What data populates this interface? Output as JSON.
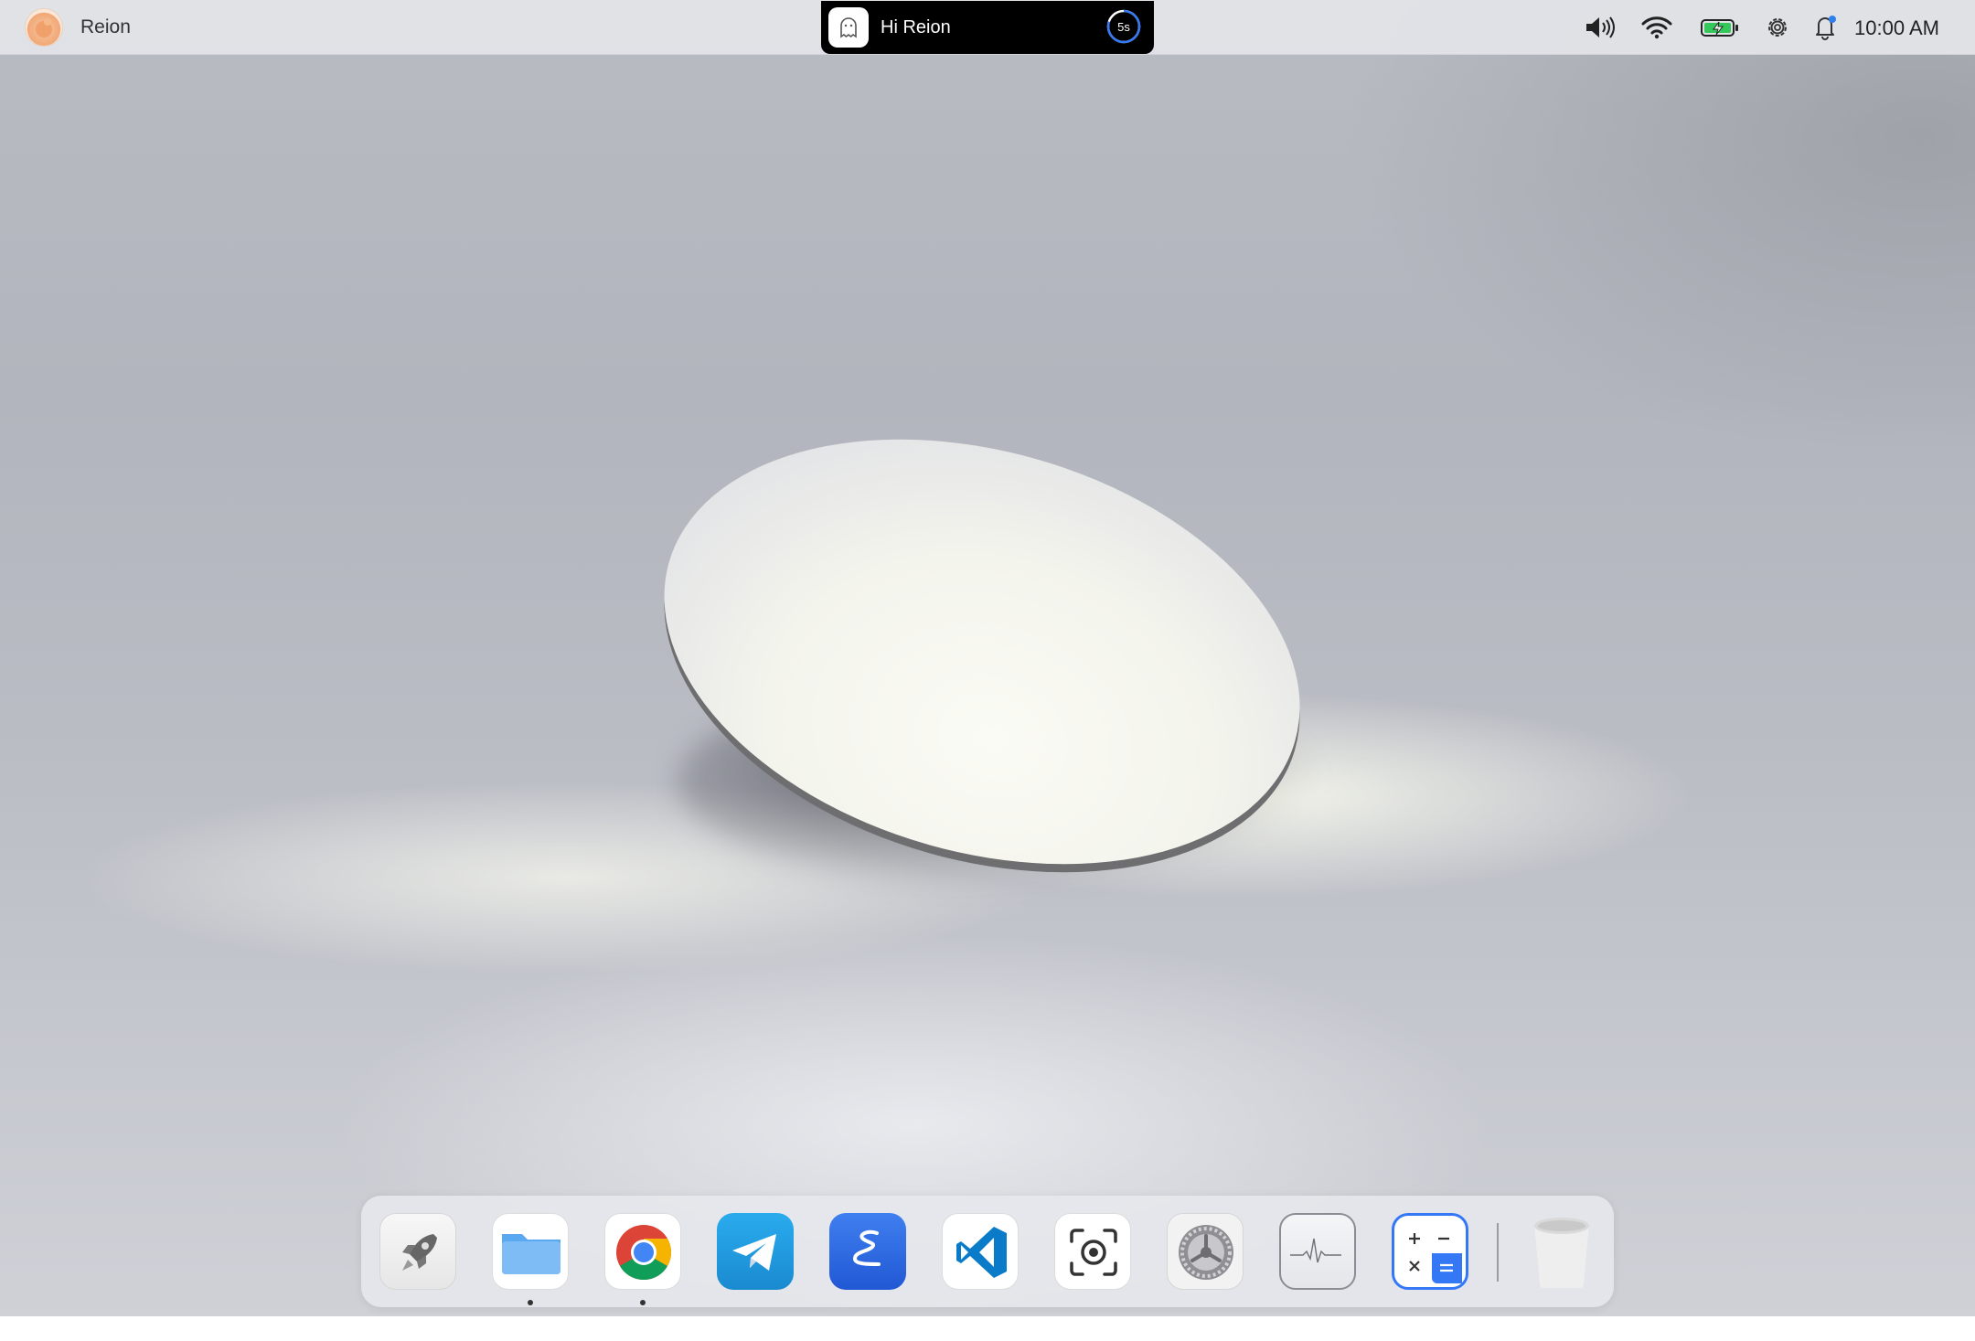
{
  "menubar": {
    "user_name": "Reion",
    "notification": {
      "text": "Hi Reion",
      "timer": "5s",
      "timer_progress": 0.8
    },
    "status_icons": [
      "volume-icon",
      "wifi-icon",
      "battery-charging-icon",
      "settings-icon",
      "notification-bell-icon"
    ],
    "clock": "10:00 AM"
  },
  "dock": {
    "apps": [
      {
        "name": "Launcher",
        "icon": "rocket-icon",
        "running": false
      },
      {
        "name": "Files",
        "icon": "folder-icon",
        "running": true
      },
      {
        "name": "Chrome",
        "icon": "chrome-icon",
        "running": true
      },
      {
        "name": "Telegram",
        "icon": "telegram-icon",
        "running": false
      },
      {
        "name": "Emacs",
        "icon": "emacs-icon",
        "running": false
      },
      {
        "name": "VS Code",
        "icon": "vscode-icon",
        "running": false
      },
      {
        "name": "Screenshot",
        "icon": "screenshot-icon",
        "running": false
      },
      {
        "name": "System Settings",
        "icon": "system-settings-icon",
        "running": false
      },
      {
        "name": "System Monitor",
        "icon": "activity-monitor-icon",
        "running": false
      },
      {
        "name": "Calculator",
        "icon": "calculator-icon",
        "running": false
      },
      {
        "name": "Trash",
        "icon": "trash-icon",
        "running": false
      }
    ]
  },
  "colors": {
    "accent_blue": "#3478f6",
    "notice_bg": "#000000",
    "notification_badge": "#2f80ed",
    "battery_green": "#34c759"
  }
}
